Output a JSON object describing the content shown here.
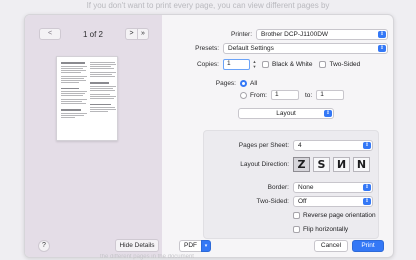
{
  "background": {
    "caption": "If you don't want to print every page, you can view different pages by",
    "caption_bottom": "the different pages in the document"
  },
  "preview": {
    "prev_label": "<",
    "page_indicator": "1 of 2",
    "next_label": ">",
    "last_label": "»",
    "help_label": "?",
    "hide_details_label": "Hide Details"
  },
  "form": {
    "printer": {
      "label": "Printer:",
      "value": "Brother DCP-J1100DW"
    },
    "presets": {
      "label": "Presets:",
      "value": "Default Settings"
    },
    "copies": {
      "label": "Copies:",
      "value": "1"
    },
    "black_white_label": "Black & White",
    "two_sided_label": "Two-Sided",
    "pages": {
      "label": "Pages:",
      "all_label": "All",
      "from_label": "From:",
      "from_value": "1",
      "to_label": "to:",
      "to_value": "1"
    },
    "section": "Layout",
    "pages_per_sheet": {
      "label": "Pages per Sheet:",
      "value": "4"
    },
    "layout_direction": {
      "label": "Layout Direction:",
      "glyphs": [
        "Z",
        "S",
        "N",
        "N"
      ]
    },
    "border": {
      "label": "Border:",
      "value": "None"
    },
    "two_sided": {
      "label": "Two-Sided:",
      "value": "Off"
    },
    "reverse_orientation_label": "Reverse page orientation",
    "flip_horizontal_label": "Flip horizontally"
  },
  "footer": {
    "pdf_label": "PDF",
    "cancel_label": "Cancel",
    "print_label": "Print"
  },
  "colors": {
    "accent": "#3478f6",
    "preview_bg": "#e4dde7"
  }
}
